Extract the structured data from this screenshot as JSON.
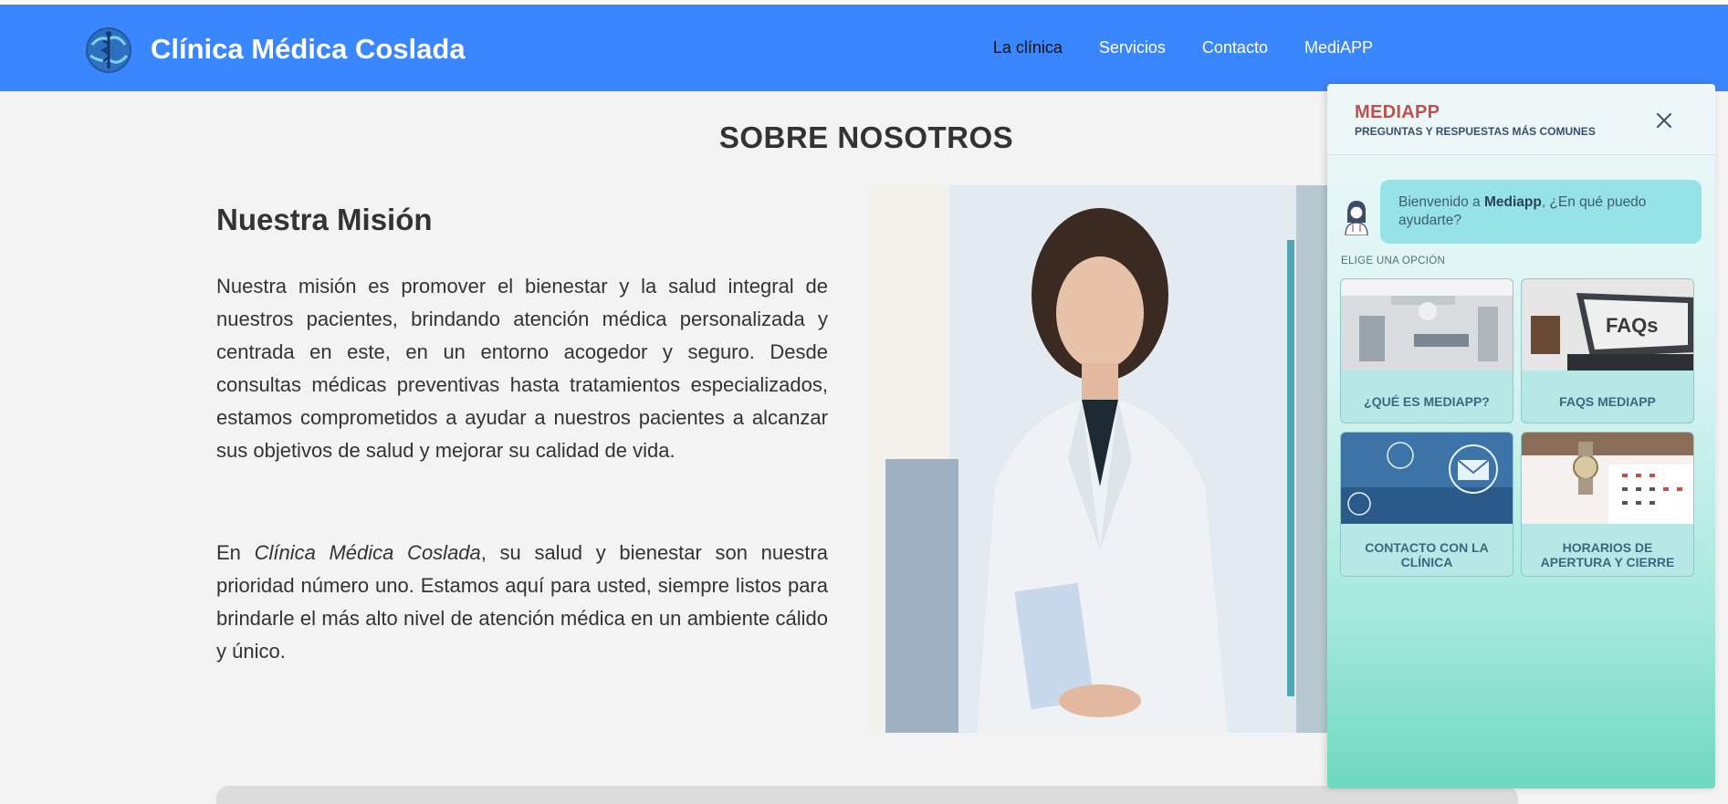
{
  "header": {
    "brand": "Clínica Médica Coslada",
    "nav": [
      {
        "label": "La clínica",
        "active": true
      },
      {
        "label": "Servicios",
        "active": false
      },
      {
        "label": "Contacto",
        "active": false
      },
      {
        "label": "MediAPP",
        "active": false
      }
    ]
  },
  "main": {
    "section_title": "SOBRE NOSOTROS",
    "mission_title": "Nuestra Misión",
    "paragraph1": "Nuestra misión es promover el bienestar y la salud integral de nuestros pacientes, brindando atención médica personalizada y centrada en este, en un entorno acogedor y seguro. Desde consultas médicas preventivas hasta tratamientos especializados, estamos comprometidos a ayudar a nuestros pacientes a alcanzar sus objetivos de salud y mejorar su calidad de vida.",
    "paragraph2_prefix": "En ",
    "paragraph2_emphasis": "Clínica Médica Coslada",
    "paragraph2_suffix": ", su salud y bienestar son nuestra prioridad número uno. Estamos aquí para usted, siempre listos para brindarle el más alto nivel de atención médica en un ambiente cálido y único."
  },
  "chat": {
    "title": "MEDIAPP",
    "subtitle": "PREGUNTAS Y RESPUESTAS MÁS COMUNES",
    "greeting_prefix": "Bienvenido a ",
    "greeting_bold": "Mediapp",
    "greeting_suffix": ", ¿En qué puedo ayudarte?",
    "choose_label": "ELIGE UNA OPCIÓN",
    "options": [
      {
        "label": "¿QUÉ ES MEDIAPP?"
      },
      {
        "label": "FAQS MEDIAPP"
      },
      {
        "label": "CONTACTO CON LA CLÍNICA"
      },
      {
        "label": "HORARIOS DE APERTURA Y CIERRE"
      }
    ]
  },
  "colors": {
    "navbar": "#3a86ff",
    "chat_title": "#c0504d",
    "chat_bubble": "#95e3e6",
    "card_label": "#3d6780"
  }
}
